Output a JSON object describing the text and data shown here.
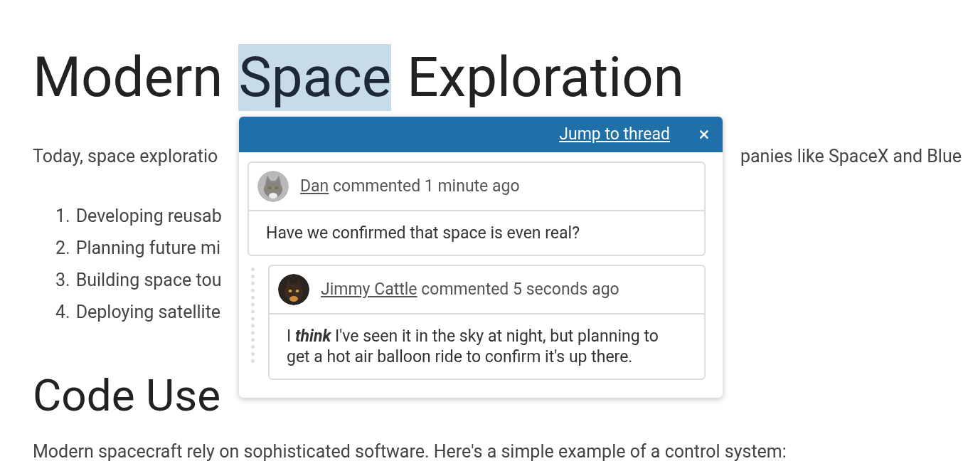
{
  "title": {
    "words": [
      {
        "text": "Modern",
        "selected": false
      },
      {
        "text": "Space",
        "selected": true
      },
      {
        "text": "Exploration",
        "selected": false
      }
    ]
  },
  "intro": {
    "start": "Today, space exploratio",
    "end": "panies like SpaceX and Blue"
  },
  "list": [
    {
      "number": "1.",
      "text": "Developing reusab"
    },
    {
      "number": "2.",
      "text": "Planning future mi"
    },
    {
      "number": "3.",
      "text": "Building space tou"
    },
    {
      "number": "4.",
      "text": "Deploying satellite"
    }
  ],
  "heading2": "Code Use",
  "outro": "Modern spacecraft rely on sophisticated software. Here's a simple example of a control system:",
  "popup": {
    "jump_link": "Jump to thread",
    "close": "×",
    "comments": [
      {
        "author": "Dan",
        "meta": "commented 1 minute ago",
        "body": "Have we confirmed that space is even real?",
        "reply": false
      },
      {
        "author": "Jimmy Cattle",
        "meta": "commented 5 seconds ago",
        "body": "I **think** I've seen it in the sky at night, but planning to get a hot air balloon ride to confirm it's up there.",
        "reply": true
      }
    ]
  }
}
